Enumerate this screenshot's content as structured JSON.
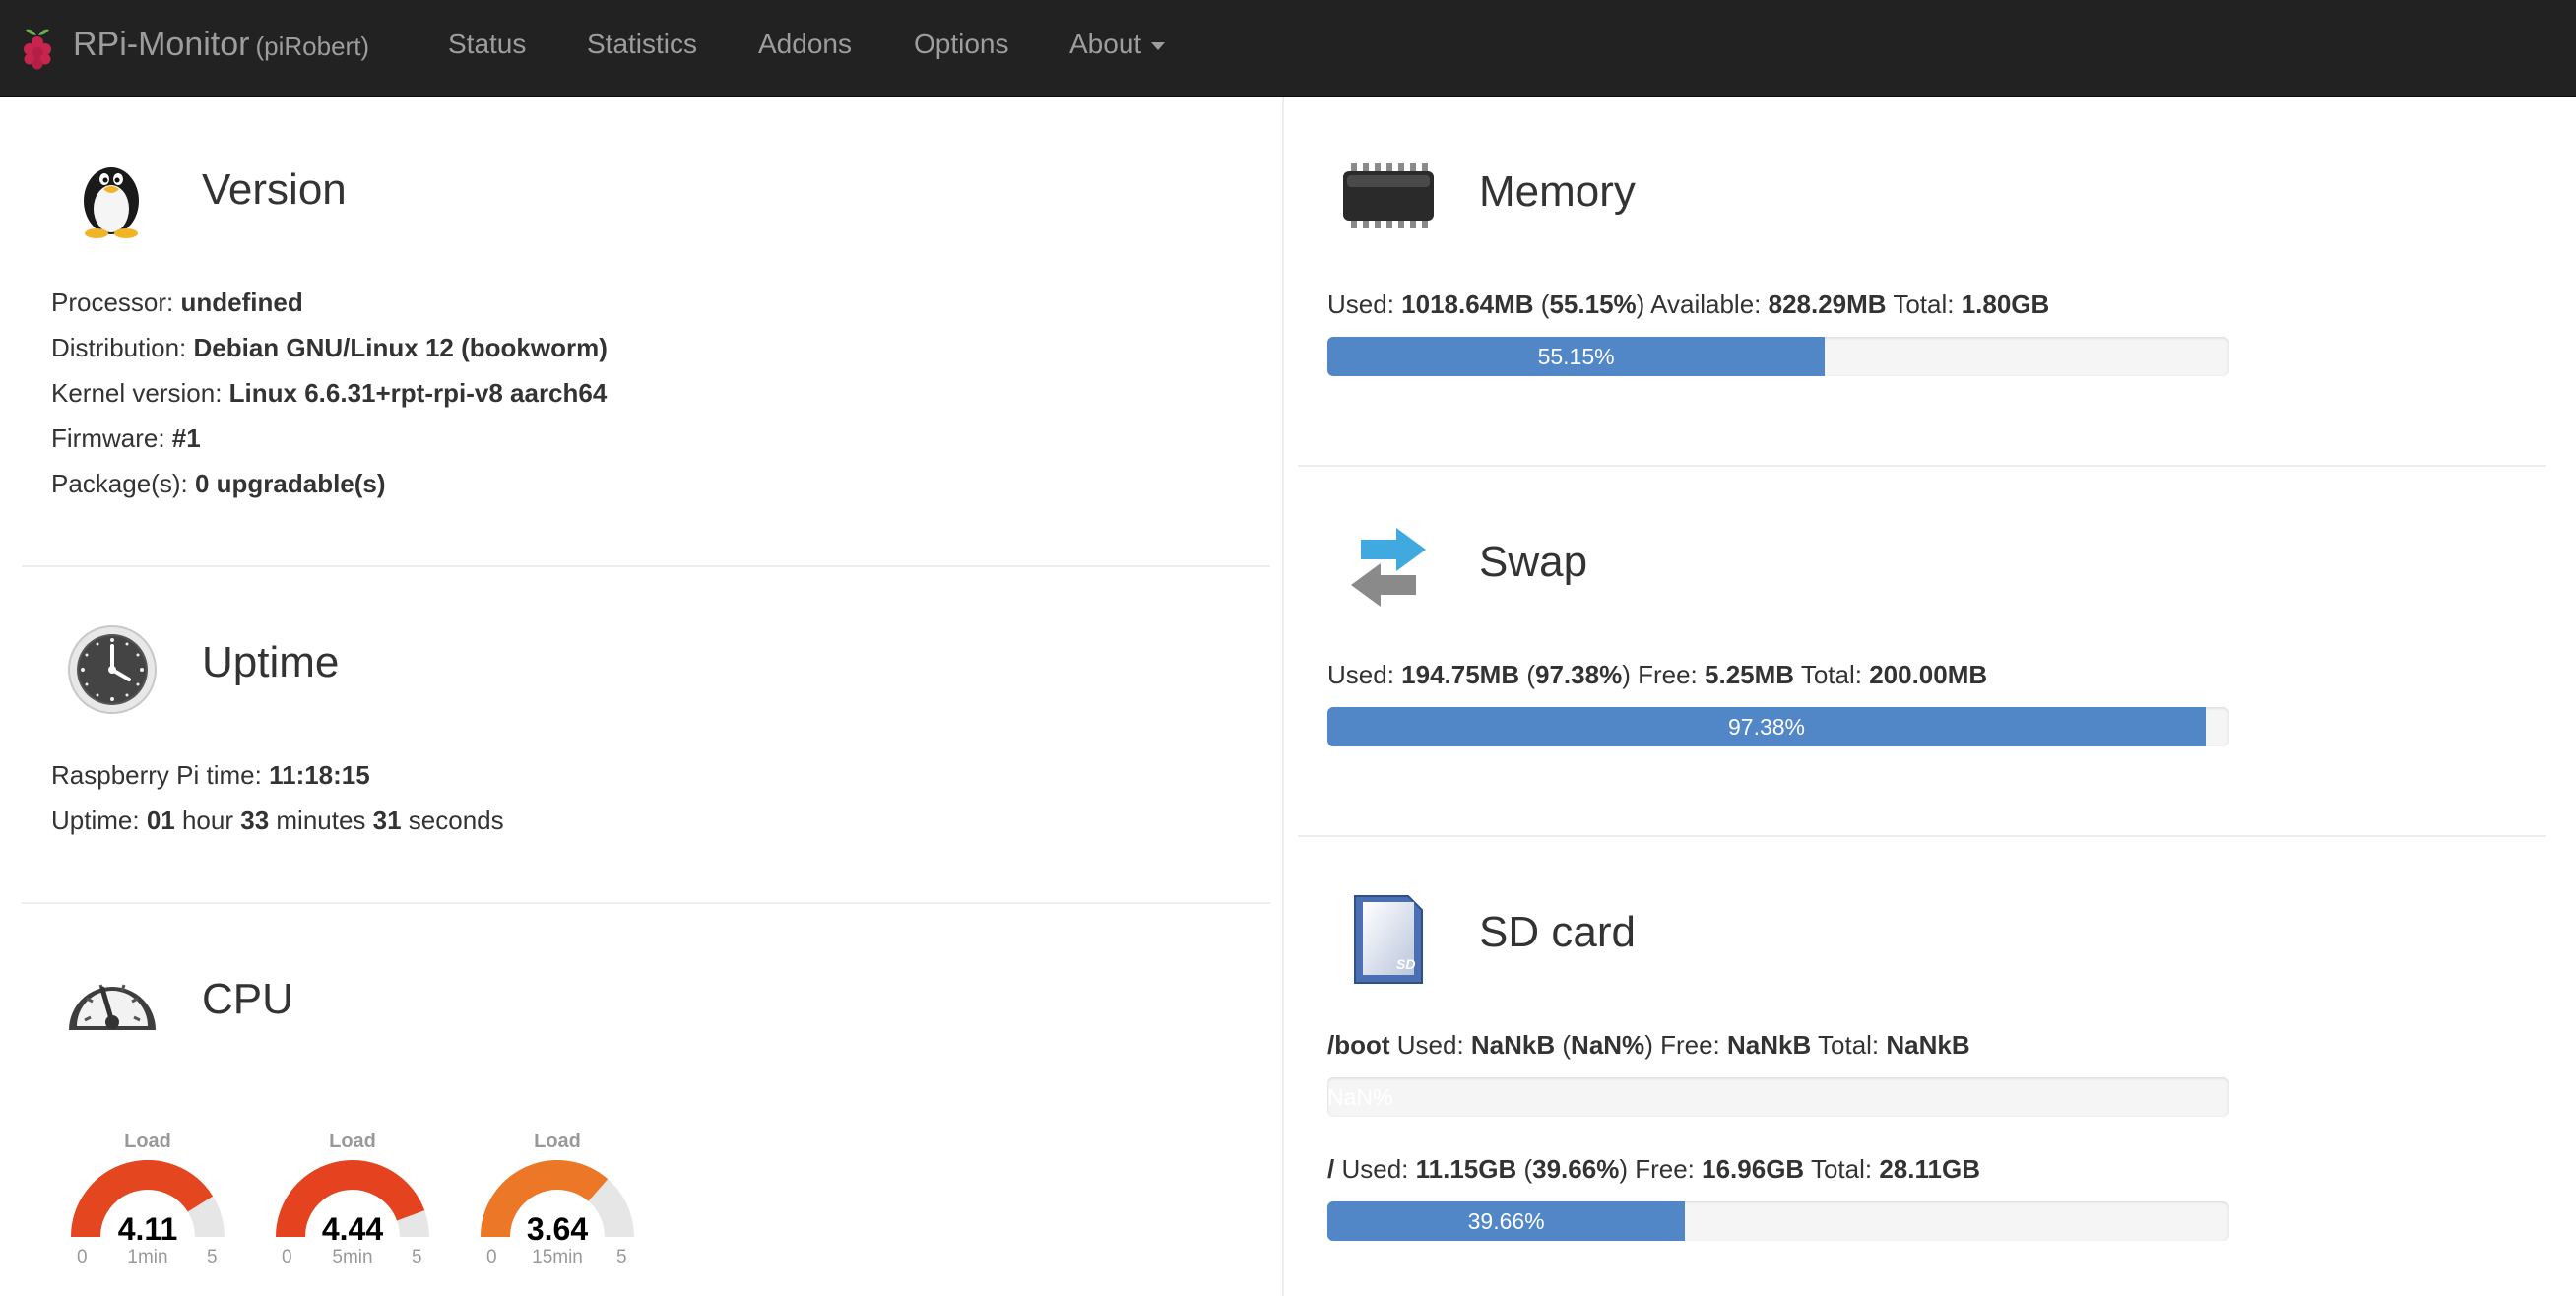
{
  "navbar": {
    "brand": "RPi-Monitor",
    "host": "(piRobert)",
    "items": [
      {
        "label": "Status"
      },
      {
        "label": "Statistics"
      },
      {
        "label": "Addons"
      },
      {
        "label": "Options"
      },
      {
        "label": "About"
      }
    ]
  },
  "version": {
    "title": "Version",
    "rows": [
      {
        "label": "Processor: ",
        "value": "undefined"
      },
      {
        "label": "Distribution: ",
        "value": "Debian GNU/Linux 12 (bookworm)"
      },
      {
        "label": "Kernel version: ",
        "value": "Linux 6.6.31+rpt-rpi-v8 aarch64"
      },
      {
        "label": "Firmware: ",
        "value": "#1"
      },
      {
        "label": "Package(s): ",
        "value": "0 upgradable(s)"
      }
    ]
  },
  "uptime": {
    "title": "Uptime",
    "time_label": "Raspberry Pi time: ",
    "time_value": "11:18:15",
    "uptime_label": "Uptime: ",
    "hours": "01",
    "hours_unit": " hour ",
    "minutes": "33",
    "minutes_unit": " minutes ",
    "seconds": "31",
    "seconds_unit": " seconds"
  },
  "cpu": {
    "title": "CPU",
    "gauges": [
      {
        "title": "Load",
        "value": "4.11",
        "label": "1min",
        "min": "0",
        "max": "5",
        "fraction": 0.822,
        "color": "#e4461f"
      },
      {
        "title": "Load",
        "value": "4.44",
        "label": "5min",
        "min": "0",
        "max": "5",
        "fraction": 0.888,
        "color": "#e5421f"
      },
      {
        "title": "Load",
        "value": "3.64",
        "label": "15min",
        "min": "0",
        "max": "5",
        "fraction": 0.728,
        "color": "#eb7727"
      }
    ]
  },
  "memory": {
    "title": "Memory",
    "used_label": "Used: ",
    "used": "1018.64MB",
    "used_pct": "55.15%",
    "available_label": " Available: ",
    "available": "828.29MB",
    "total_label": " Total: ",
    "total": "1.80GB",
    "bar_label": "55.15%",
    "fraction": 0.5515
  },
  "swap": {
    "title": "Swap",
    "used_label": "Used: ",
    "used": "194.75MB",
    "used_pct": "97.38%",
    "free_label": " Free: ",
    "free": "5.25MB",
    "total_label": " Total: ",
    "total": "200.00MB",
    "bar_label": "97.38%",
    "fraction": 0.9738
  },
  "sdcard": {
    "title": "SD card",
    "partitions": [
      {
        "mount": "/boot",
        "used_label": " Used: ",
        "used": "NaNkB",
        "used_pct": "NaN%",
        "free_label": " Free: ",
        "free": "NaNkB",
        "total_label": " Total: ",
        "total": "NaNkB",
        "bar_label": "NaN%",
        "fraction": 0
      },
      {
        "mount": "/",
        "used_label": " Used: ",
        "used": "11.15GB",
        "used_pct": "39.66%",
        "free_label": " Free: ",
        "free": "16.96GB",
        "total_label": " Total: ",
        "total": "28.11GB",
        "bar_label": "39.66%",
        "fraction": 0.3966
      }
    ]
  },
  "colors": {
    "navbar": "#222222",
    "nav_text": "#9d9d9d",
    "progress": "#5187c6"
  }
}
